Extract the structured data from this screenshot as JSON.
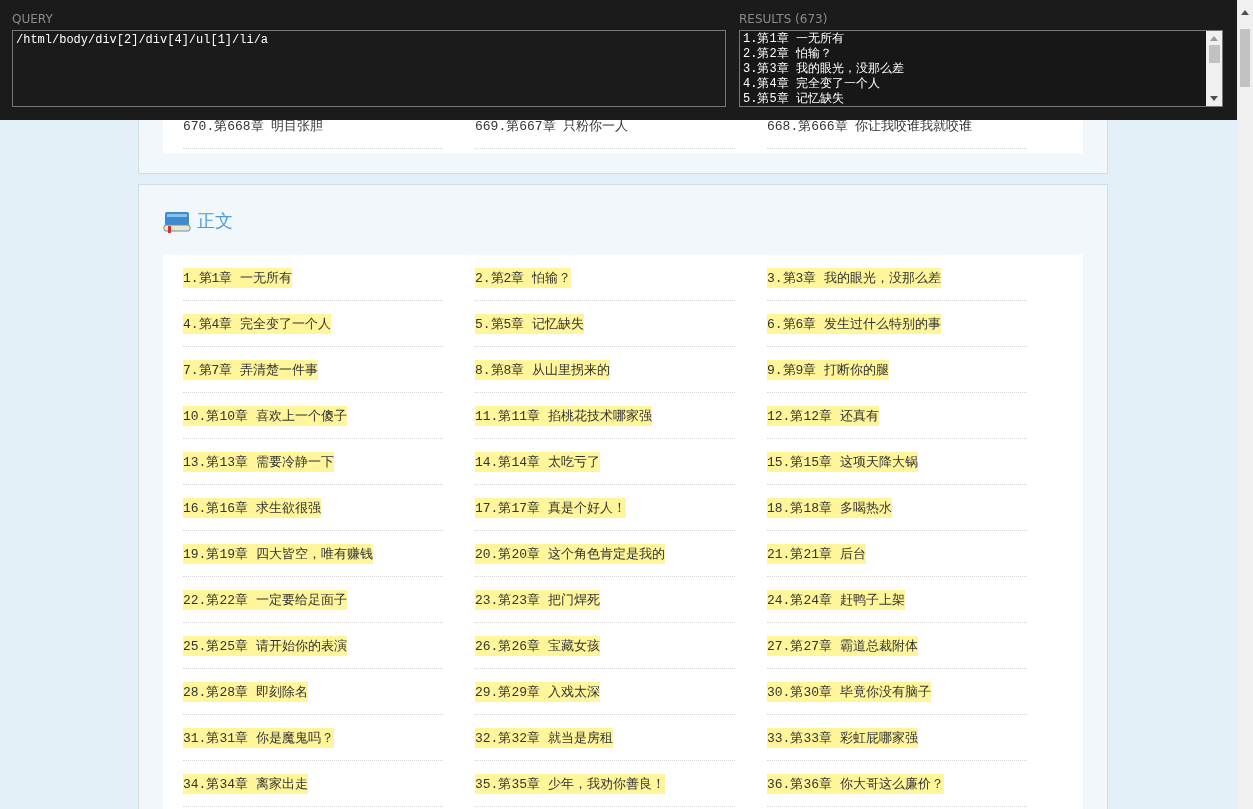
{
  "overlay": {
    "query_label": "QUERY",
    "query": "/html/body/div[2]/div[4]/ul[1]/li/a",
    "results_label": "RESULTS (673)",
    "results": [
      "1.第1章 一无所有",
      "2.第2章 怕输？",
      "3.第3章 我的眼光，没那么差",
      "4.第4章 完全变了一个人",
      "5.第5章 记忆缺失"
    ]
  },
  "sections": [
    {
      "rows": [
        [
          {
            "text": "670.第668章 明目张胆",
            "highlighted": false
          },
          {
            "text": "669.第667章 只粉你一人",
            "highlighted": false
          },
          {
            "text": "668.第666章 你让我咬谁我就咬谁",
            "highlighted": false
          }
        ]
      ]
    },
    {
      "title": "正文",
      "rows": [
        [
          {
            "text": "1.第1章 一无所有",
            "highlighted": true
          },
          {
            "text": "2.第2章 怕输？",
            "highlighted": true
          },
          {
            "text": "3.第3章 我的眼光，没那么差",
            "highlighted": true
          }
        ],
        [
          {
            "text": "4.第4章 完全变了一个人",
            "highlighted": true
          },
          {
            "text": "5.第5章 记忆缺失",
            "highlighted": true
          },
          {
            "text": "6.第6章 发生过什么特别的事",
            "highlighted": true
          }
        ],
        [
          {
            "text": "7.第7章 弄清楚一件事",
            "highlighted": true
          },
          {
            "text": "8.第8章 从山里拐来的",
            "highlighted": true
          },
          {
            "text": "9.第9章 打断你的腿",
            "highlighted": true
          }
        ],
        [
          {
            "text": "10.第10章 喜欢上一个傻子",
            "highlighted": true
          },
          {
            "text": "11.第11章 掐桃花技术哪家强",
            "highlighted": true
          },
          {
            "text": "12.第12章 还真有",
            "highlighted": true
          }
        ],
        [
          {
            "text": "13.第13章 需要冷静一下",
            "highlighted": true
          },
          {
            "text": "14.第14章 太吃亏了",
            "highlighted": true
          },
          {
            "text": "15.第15章 这项天降大锅",
            "highlighted": true
          }
        ],
        [
          {
            "text": "16.第16章 求生欲很强",
            "highlighted": true
          },
          {
            "text": "17.第17章 真是个好人！",
            "highlighted": true
          },
          {
            "text": "18.第18章 多喝热水",
            "highlighted": true
          }
        ],
        [
          {
            "text": "19.第19章 四大皆空，唯有赚钱",
            "highlighted": true
          },
          {
            "text": "20.第20章 这个角色肯定是我的",
            "highlighted": true
          },
          {
            "text": "21.第21章 后台",
            "highlighted": true
          }
        ],
        [
          {
            "text": "22.第22章 一定要给足面子",
            "highlighted": true
          },
          {
            "text": "23.第23章 把门焊死",
            "highlighted": true
          },
          {
            "text": "24.第24章 赶鸭子上架",
            "highlighted": true
          }
        ],
        [
          {
            "text": "25.第25章 请开始你的表演",
            "highlighted": true
          },
          {
            "text": "26.第26章 宝藏女孩",
            "highlighted": true
          },
          {
            "text": "27.第27章 霸道总裁附体",
            "highlighted": true
          }
        ],
        [
          {
            "text": "28.第28章 即刻除名",
            "highlighted": true
          },
          {
            "text": "29.第29章 入戏太深",
            "highlighted": true
          },
          {
            "text": "30.第30章 毕竟你没有脑子",
            "highlighted": true
          }
        ],
        [
          {
            "text": "31.第31章 你是魔鬼吗？",
            "highlighted": true
          },
          {
            "text": "32.第32章 就当是房租",
            "highlighted": true
          },
          {
            "text": "33.第33章 彩虹屁哪家强",
            "highlighted": true
          }
        ],
        [
          {
            "text": "34.第34章 离家出走",
            "highlighted": true
          },
          {
            "text": "35.第35章 少年，我劝你善良！",
            "highlighted": true
          },
          {
            "text": "36.第36章 你大哥这么廉价？",
            "highlighted": true
          }
        ]
      ]
    }
  ]
}
